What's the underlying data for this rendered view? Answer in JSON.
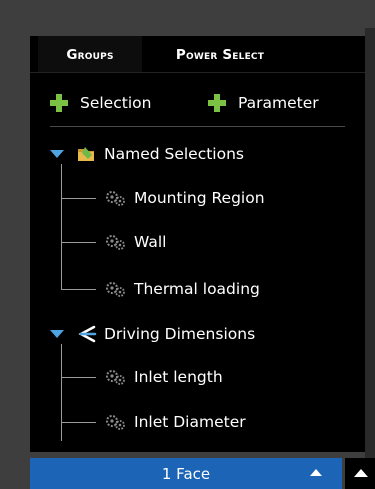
{
  "tabs": {
    "groups": "Groups",
    "power_select": "Power Select"
  },
  "toolbar": {
    "selection_label": "Selection",
    "parameter_label": "Parameter"
  },
  "tree": {
    "named_selections": {
      "label": "Named Selections",
      "children": [
        "Mounting Region",
        "Wall",
        "Thermal loading"
      ]
    },
    "driving_dimensions": {
      "label": "Driving Dimensions",
      "children": [
        "Inlet length",
        "Inlet Diameter"
      ]
    }
  },
  "status": {
    "label": "1 Face"
  },
  "colors": {
    "accent_blue": "#1c64b6",
    "add_green": "#7bc143",
    "expander_blue": "#4fa3e0"
  },
  "icons": [
    "plus-icon",
    "expand-arrow-icon",
    "folder-icon",
    "driving-dimensions-icon",
    "gear-icon",
    "caret-up-icon"
  ]
}
